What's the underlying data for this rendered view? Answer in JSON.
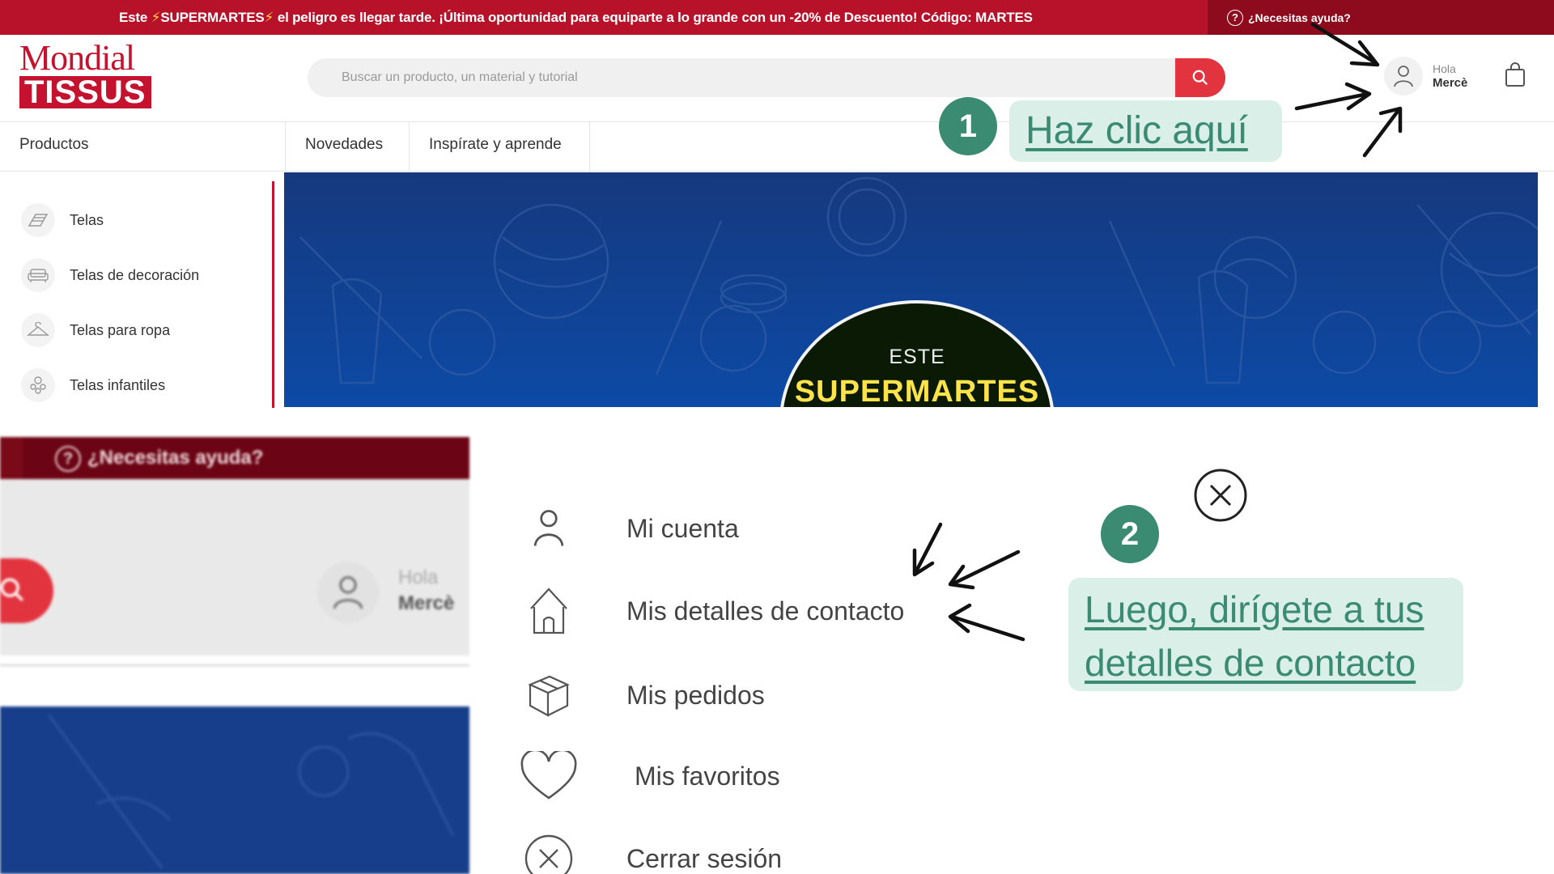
{
  "promo": {
    "part1": "Este ",
    "bolt": "⚡",
    "highlight": "SUPERMARTES",
    "part2": " el peligro es llegar tarde. ¡Última oportunidad para equiparte a lo grande con un -20% de Descuento! Código: MARTES",
    "help": "¿Necesitas ayuda?"
  },
  "header": {
    "logo_top": "Mondial",
    "logo_bottom": "TISSUS",
    "search_placeholder": "Buscar un producto, un material y tutorial",
    "greeting": "Hola",
    "user_name": "Mercè"
  },
  "nav": {
    "products": "Productos",
    "items": [
      "Novedades",
      "Inspírate y aprende"
    ]
  },
  "sidebar": {
    "items": [
      {
        "label": "Telas",
        "icon": "fabric-icon"
      },
      {
        "label": "Telas de decoración",
        "icon": "sofa-icon"
      },
      {
        "label": "Telas para ropa",
        "icon": "hanger-icon"
      },
      {
        "label": "Telas infantiles",
        "icon": "rocking-horse-icon"
      }
    ]
  },
  "banner": {
    "badge_top": "ESTE",
    "badge_main": "SUPERMARTES"
  },
  "step1": {
    "number": "1",
    "text": "Haz clic aquí"
  },
  "zoom": {
    "help": "¿Necesitas ayuda?",
    "greeting": "Hola",
    "user_name": "Mercè"
  },
  "account_menu": {
    "items": [
      {
        "label": "Mi cuenta",
        "icon": "user-icon"
      },
      {
        "label": "Mis detalles de contacto",
        "icon": "house-icon"
      },
      {
        "label": "Mis pedidos",
        "icon": "box-icon"
      },
      {
        "label": "Mis favoritos",
        "icon": "heart-icon"
      },
      {
        "label": "Cerrar sesión",
        "icon": "close-circle-icon"
      }
    ]
  },
  "step2": {
    "number": "2",
    "line1": "Luego, dirígete a tus",
    "line2": "detalles de contacto"
  },
  "colors": {
    "brand_red": "#c4122f",
    "promo_red": "#b8122a",
    "search_red": "#e2343e",
    "banner_blue": "#0c4aa6",
    "callout_green": "#3b8a72",
    "callout_bg": "#d9efe8",
    "badge_yellow": "#ffe34a"
  }
}
